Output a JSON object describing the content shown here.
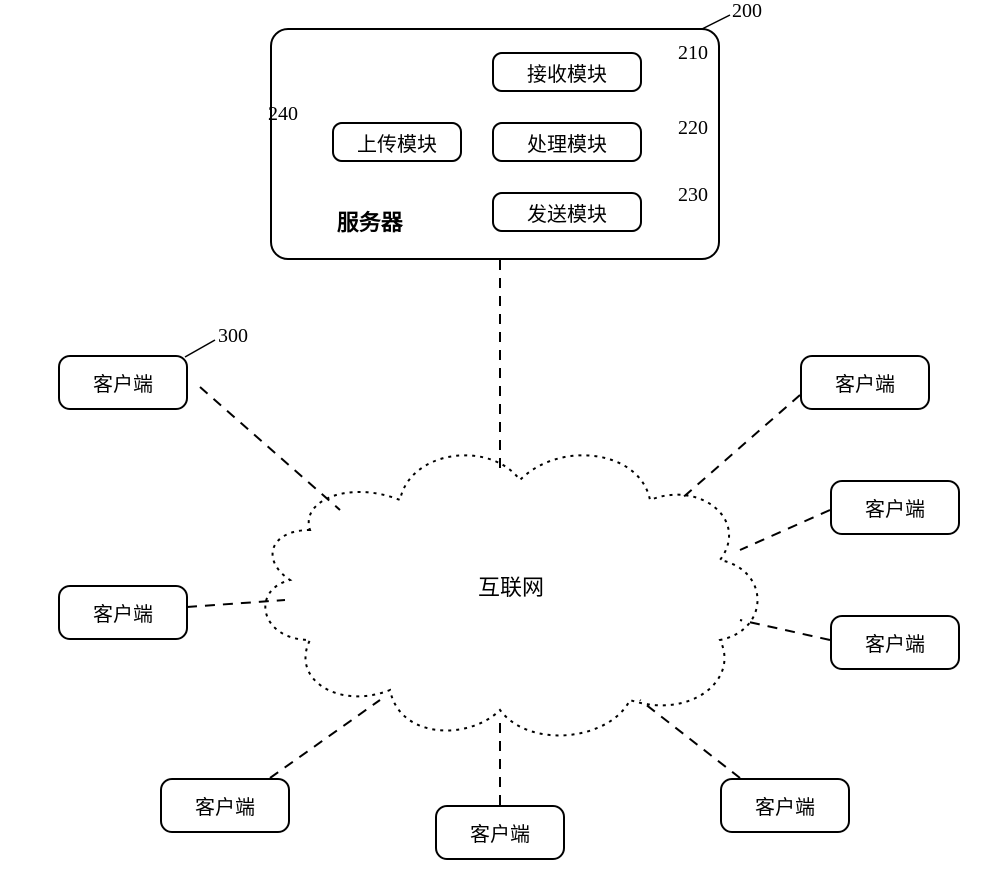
{
  "server": {
    "label": "服务器",
    "ref": "200",
    "modules": {
      "receive": {
        "label": "接收模块",
        "ref": "210"
      },
      "process": {
        "label": "处理模块",
        "ref": "220"
      },
      "send": {
        "label": "发送模块",
        "ref": "230"
      },
      "upload": {
        "label": "上传模块",
        "ref": "240"
      }
    }
  },
  "internet": {
    "label": "互联网"
  },
  "client": {
    "label": "客户端",
    "ref": "300"
  },
  "clients": [
    {
      "label": "客户端"
    },
    {
      "label": "客户端"
    },
    {
      "label": "客户端"
    },
    {
      "label": "客户端"
    },
    {
      "label": "客户端"
    },
    {
      "label": "客户端"
    },
    {
      "label": "客户端"
    },
    {
      "label": "客户端"
    }
  ]
}
